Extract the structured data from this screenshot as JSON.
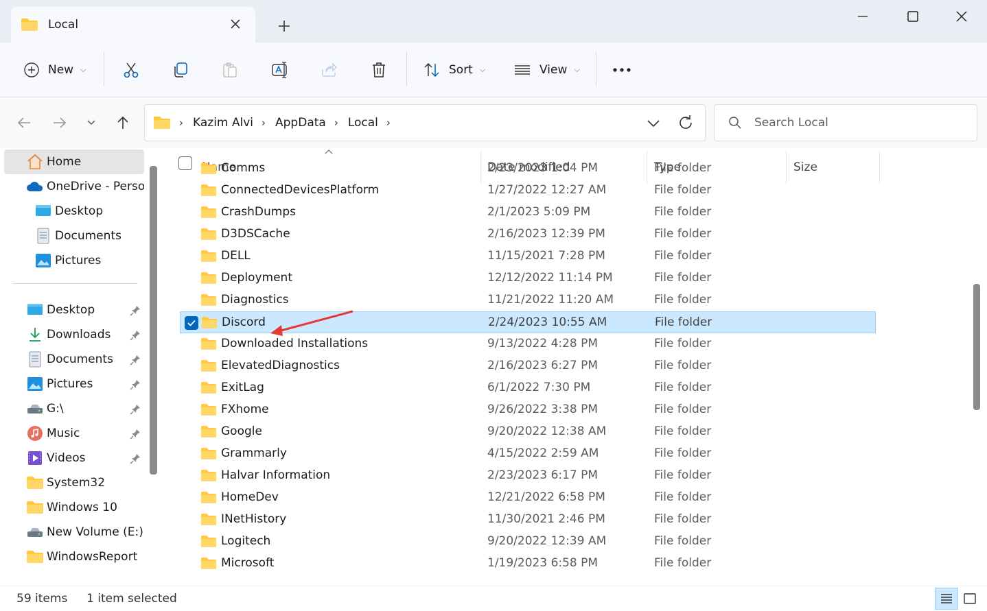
{
  "window": {
    "tab_title": "Local",
    "new_tab_symbol": "+"
  },
  "toolbar": {
    "new_label": "New",
    "sort_label": "Sort",
    "view_label": "View",
    "icons": [
      "cut-icon",
      "copy-icon",
      "paste-icon",
      "rename-icon",
      "share-icon",
      "delete-icon",
      "more-icon"
    ]
  },
  "address": {
    "crumbs": [
      "Kazim Alvi",
      "AppData",
      "Local"
    ]
  },
  "search": {
    "placeholder": "Search Local"
  },
  "sidebar": {
    "items": [
      {
        "label": "Home"
      },
      {
        "label": "OneDrive - Personal"
      },
      {
        "label": "Desktop"
      },
      {
        "label": "Documents"
      },
      {
        "label": "Pictures"
      },
      {
        "label": "Desktop"
      },
      {
        "label": "Downloads"
      },
      {
        "label": "Documents"
      },
      {
        "label": "Pictures"
      },
      {
        "label": "G:\\"
      },
      {
        "label": "Music"
      },
      {
        "label": "Videos"
      },
      {
        "label": "System32"
      },
      {
        "label": "Windows 10"
      },
      {
        "label": "New Volume (E:)"
      },
      {
        "label": "WindowsReport"
      }
    ]
  },
  "columns": {
    "name": "Name",
    "date": "Date modified",
    "type": "Type",
    "size": "Size"
  },
  "files": [
    {
      "name": "Comms",
      "date": "2/23/2023 1:04 PM",
      "type": "File folder"
    },
    {
      "name": "ConnectedDevicesPlatform",
      "date": "1/27/2022 12:27 AM",
      "type": "File folder"
    },
    {
      "name": "CrashDumps",
      "date": "2/1/2023 5:09 PM",
      "type": "File folder"
    },
    {
      "name": "D3DSCache",
      "date": "2/16/2023 12:39 PM",
      "type": "File folder"
    },
    {
      "name": "DELL",
      "date": "11/15/2021 7:28 PM",
      "type": "File folder"
    },
    {
      "name": "Deployment",
      "date": "12/12/2022 11:14 PM",
      "type": "File folder"
    },
    {
      "name": "Diagnostics",
      "date": "11/21/2022 11:20 AM",
      "type": "File folder"
    },
    {
      "name": "Discord",
      "date": "2/24/2023 10:55 AM",
      "type": "File folder"
    },
    {
      "name": "Downloaded Installations",
      "date": "9/13/2022 4:28 PM",
      "type": "File folder"
    },
    {
      "name": "ElevatedDiagnostics",
      "date": "2/16/2023 6:27 PM",
      "type": "File folder"
    },
    {
      "name": "ExitLag",
      "date": "6/1/2022 7:30 PM",
      "type": "File folder"
    },
    {
      "name": "FXhome",
      "date": "9/26/2022 3:38 PM",
      "type": "File folder"
    },
    {
      "name": "Google",
      "date": "9/20/2022 12:38 AM",
      "type": "File folder"
    },
    {
      "name": "Grammarly",
      "date": "4/15/2022 2:59 AM",
      "type": "File folder"
    },
    {
      "name": "Halvar Information",
      "date": "2/23/2023 6:17 PM",
      "type": "File folder"
    },
    {
      "name": "HomeDev",
      "date": "12/21/2022 6:58 PM",
      "type": "File folder"
    },
    {
      "name": "INetHistory",
      "date": "11/30/2021 2:46 PM",
      "type": "File folder"
    },
    {
      "name": "Logitech",
      "date": "9/20/2022 12:39 AM",
      "type": "File folder"
    },
    {
      "name": "Microsoft",
      "date": "1/19/2023 6:58 PM",
      "type": "File folder"
    }
  ],
  "selected_file": "Discord",
  "status": {
    "count": "59 items",
    "selection": "1 item selected"
  },
  "colors": {
    "accent": "#0067c0",
    "selection": "#cce8ff",
    "annotation_arrow": "#e53935",
    "folder": "#ffc83d"
  }
}
